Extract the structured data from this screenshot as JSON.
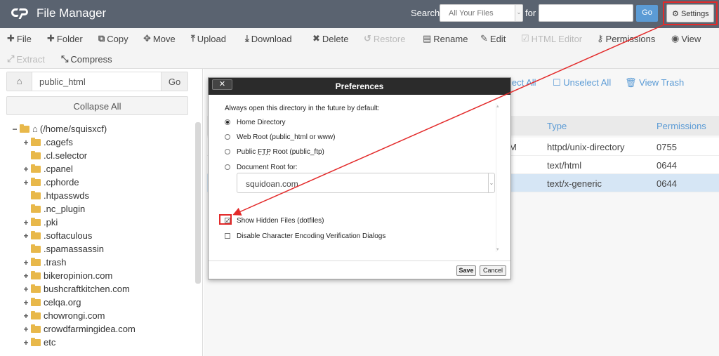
{
  "header": {
    "app_title": "File Manager",
    "search_label": "Search",
    "search_scope": "All Your Files",
    "for_label": "for",
    "search_value": "",
    "go_label": "Go",
    "settings_label": "Settings"
  },
  "toolbar": {
    "file": "File",
    "folder": "Folder",
    "copy": "Copy",
    "move": "Move",
    "upload": "Upload",
    "download": "Download",
    "delete": "Delete",
    "restore": "Restore",
    "rename": "Rename",
    "edit": "Edit",
    "html_editor": "HTML Editor",
    "permissions": "Permissions",
    "view": "View",
    "extract": "Extract",
    "compress": "Compress"
  },
  "left": {
    "path_value": "public_html",
    "go_label": "Go",
    "collapse_label": "Collapse All",
    "tree": [
      {
        "label": "(/home/squisxcf)",
        "toggle": "−",
        "level": 0,
        "home": true
      },
      {
        "label": ".cagefs",
        "toggle": "+",
        "level": 1
      },
      {
        "label": ".cl.selector",
        "toggle": "",
        "level": 1
      },
      {
        "label": ".cpanel",
        "toggle": "+",
        "level": 1
      },
      {
        "label": ".cphorde",
        "toggle": "+",
        "level": 1
      },
      {
        "label": ".htpasswds",
        "toggle": "",
        "level": 1
      },
      {
        "label": ".nc_plugin",
        "toggle": "",
        "level": 1
      },
      {
        "label": ".pki",
        "toggle": "+",
        "level": 1
      },
      {
        "label": ".softaculous",
        "toggle": "+",
        "level": 1
      },
      {
        "label": ".spamassassin",
        "toggle": "",
        "level": 1
      },
      {
        "label": ".trash",
        "toggle": "+",
        "level": 1
      },
      {
        "label": "bikeropinion.com",
        "toggle": "+",
        "level": 1
      },
      {
        "label": "bushcraftkitchen.com",
        "toggle": "+",
        "level": 1
      },
      {
        "label": "celqa.org",
        "toggle": "+",
        "level": 1
      },
      {
        "label": "chowrongi.com",
        "toggle": "+",
        "level": 1
      },
      {
        "label": "crowdfarmingidea.com",
        "toggle": "+",
        "level": 1
      },
      {
        "label": "etc",
        "toggle": "+",
        "level": 1
      }
    ]
  },
  "right": {
    "select_all_partial": "lect All",
    "unselect_all": "Unselect All",
    "view_trash": "View Trash",
    "columns": {
      "type": "Type",
      "permissions": "Permissions"
    },
    "rows": [
      {
        "partial": "M",
        "type": "httpd/unix-directory",
        "perms": "0755"
      },
      {
        "partial": "",
        "type": "text/html",
        "perms": "0644"
      },
      {
        "partial": "",
        "type": "text/x-generic",
        "perms": "0644"
      }
    ]
  },
  "modal": {
    "title": "Preferences",
    "close_label": "✕",
    "intro": "Always open this directory in the future by default:",
    "opt_home": "Home Directory",
    "opt_webroot": "Web Root (public_html or www)",
    "opt_ftp_prefix": "Public ",
    "opt_ftp_abbr": "FTP",
    "opt_ftp_suffix": " Root (public_ftp)",
    "opt_docroot": "Document Root for:",
    "domain_value": "squidoan.com",
    "show_hidden": "Show Hidden Files (dotfiles)",
    "disable_encoding": "Disable Character Encoding Verification Dialogs",
    "save_label": "Save",
    "cancel_label": "Cancel"
  },
  "colors": {
    "header_bg": "#5a6370",
    "link_blue": "#5b9bd5",
    "highlight_red": "#e32a2a",
    "folder_yellow": "#e8b84a"
  }
}
